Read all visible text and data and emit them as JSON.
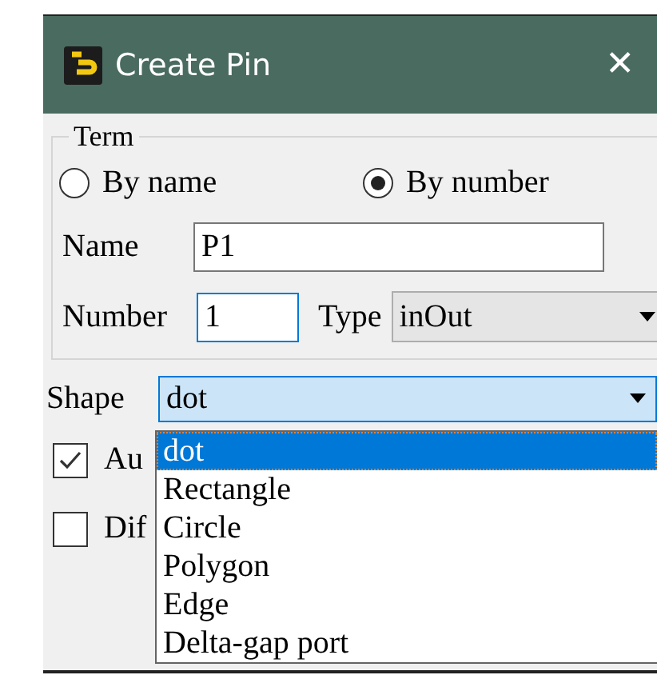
{
  "window": {
    "title": "Create Pin",
    "close": "✕"
  },
  "term": {
    "legend": "Term",
    "options": [
      {
        "label": "By name",
        "selected": false
      },
      {
        "label": "By number",
        "selected": true
      }
    ],
    "name": {
      "label": "Name",
      "value": "P1"
    },
    "number": {
      "label": "Number",
      "value": "1"
    },
    "type": {
      "label": "Type",
      "value": "inOut"
    }
  },
  "shape": {
    "label": "Shape",
    "value": "dot",
    "expanded": true,
    "options": [
      {
        "label": "dot",
        "selected": true
      },
      {
        "label": "Rectangle",
        "selected": false
      },
      {
        "label": "Circle",
        "selected": false
      },
      {
        "label": "Polygon",
        "selected": false
      },
      {
        "label": "Edge",
        "selected": false
      },
      {
        "label": "Delta-gap port",
        "selected": false
      }
    ]
  },
  "checkboxes": [
    {
      "label": "Au",
      "checked": true
    },
    {
      "label": "Dif",
      "checked": false
    }
  ]
}
